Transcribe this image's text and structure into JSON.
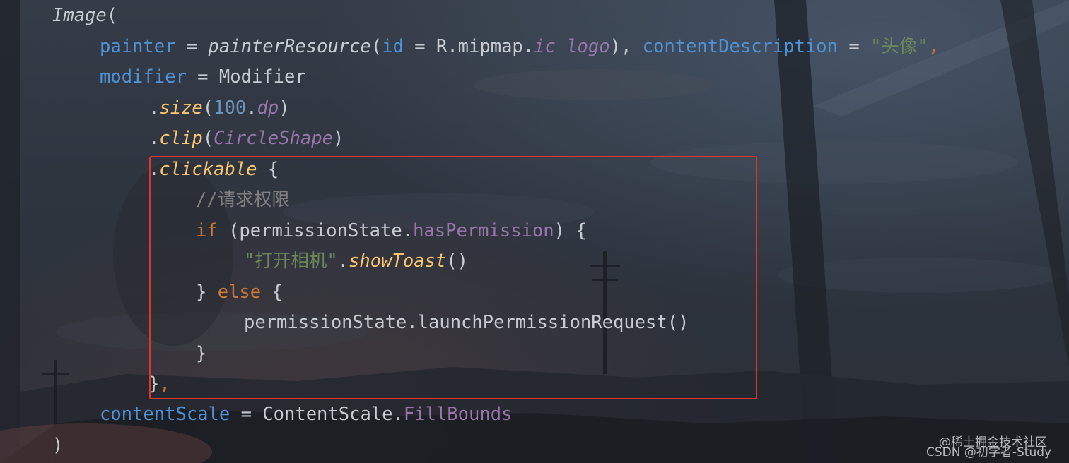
{
  "code": {
    "lines": [
      {
        "tokens": [
          {
            "t": "Image",
            "c": "ident italic"
          },
          {
            "t": "(",
            "c": "punc"
          }
        ]
      },
      {
        "tokens": [
          {
            "t": "painter",
            "c": "param"
          },
          {
            "t": " = ",
            "c": "op"
          },
          {
            "t": "painterResource",
            "c": "ident italic"
          },
          {
            "t": "(",
            "c": "punc"
          },
          {
            "t": "id",
            "c": "param"
          },
          {
            "t": " = ",
            "c": "op"
          },
          {
            "t": "R.mipmap.",
            "c": "ident"
          },
          {
            "t": "ic_logo",
            "c": "prop italic"
          },
          {
            "t": "), ",
            "c": "punc"
          },
          {
            "t": "contentDescription",
            "c": "param"
          },
          {
            "t": " = ",
            "c": "op"
          },
          {
            "t": "\"头像\"",
            "c": "str"
          },
          {
            "t": ",",
            "c": "kw"
          }
        ]
      },
      {
        "tokens": [
          {
            "t": "modifier",
            "c": "param"
          },
          {
            "t": " = ",
            "c": "op"
          },
          {
            "t": "Modifier",
            "c": "ident"
          }
        ]
      },
      {
        "tokens": [
          {
            "t": ".",
            "c": "punc"
          },
          {
            "t": "size",
            "c": "fn"
          },
          {
            "t": "(",
            "c": "punc"
          },
          {
            "t": "100",
            "c": "num"
          },
          {
            "t": ".",
            "c": "punc"
          },
          {
            "t": "dp",
            "c": "prop italic"
          },
          {
            "t": ")",
            "c": "punc"
          }
        ]
      },
      {
        "tokens": [
          {
            "t": ".",
            "c": "punc"
          },
          {
            "t": "clip",
            "c": "fn"
          },
          {
            "t": "(",
            "c": "punc"
          },
          {
            "t": "CircleShape",
            "c": "prop italic"
          },
          {
            "t": ")",
            "c": "punc"
          }
        ]
      },
      {
        "tokens": [
          {
            "t": ".",
            "c": "punc"
          },
          {
            "t": "clickable",
            "c": "fn"
          },
          {
            "t": " {",
            "c": "punc"
          }
        ]
      },
      {
        "tokens": [
          {
            "t": "//请求权限",
            "c": "comment"
          }
        ]
      },
      {
        "tokens": [
          {
            "t": "if",
            "c": "kw"
          },
          {
            "t": " (permissionState.",
            "c": "ident"
          },
          {
            "t": "hasPermission",
            "c": "prop"
          },
          {
            "t": ") {",
            "c": "punc"
          }
        ]
      },
      {
        "tokens": [
          {
            "t": "\"打开相机\"",
            "c": "str"
          },
          {
            "t": ".",
            "c": "punc"
          },
          {
            "t": "showToast",
            "c": "fn"
          },
          {
            "t": "()",
            "c": "punc"
          }
        ]
      },
      {
        "tokens": [
          {
            "t": "} ",
            "c": "punc"
          },
          {
            "t": "else",
            "c": "kw"
          },
          {
            "t": " {",
            "c": "punc"
          }
        ]
      },
      {
        "tokens": [
          {
            "t": "permissionState.launchPermissionRequest()",
            "c": "ident"
          }
        ]
      },
      {
        "tokens": [
          {
            "t": "}",
            "c": "punc"
          }
        ]
      },
      {
        "tokens": [
          {
            "t": "}",
            "c": "punc"
          },
          {
            "t": ",",
            "c": "kw"
          }
        ]
      },
      {
        "tokens": [
          {
            "t": "contentScale",
            "c": "param"
          },
          {
            "t": " = ",
            "c": "op"
          },
          {
            "t": "ContentScale.",
            "c": "ident"
          },
          {
            "t": "FillBounds",
            "c": "prop"
          }
        ]
      },
      {
        "tokens": [
          {
            "t": ")",
            "c": "punc"
          }
        ]
      }
    ]
  },
  "watermark": {
    "site": "@稀土掘金技术社区",
    "author": "CSDN @初学者-Study"
  },
  "colors": {
    "highlight_border": "#e0342f",
    "keyword": "#cc7832",
    "parameter": "#4e93d9",
    "function": "#ffc66d",
    "property": "#9876aa",
    "string": "#6a8759",
    "comment": "#808080",
    "number": "#6897bb",
    "text": "#c8ccd2"
  }
}
